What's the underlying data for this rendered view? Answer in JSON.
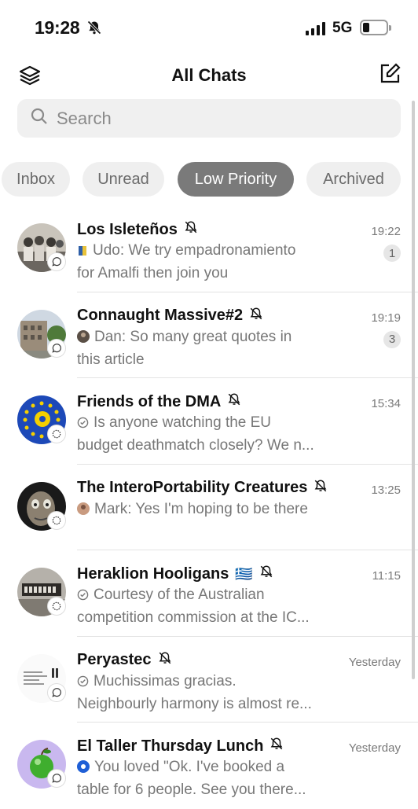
{
  "status": {
    "time": "19:28",
    "network": "5G"
  },
  "header": {
    "title": "All Chats"
  },
  "search": {
    "placeholder": "Search"
  },
  "filters": [
    {
      "label": "Inbox"
    },
    {
      "label": "Unread"
    },
    {
      "label": "Low Priority",
      "active": true
    },
    {
      "label": "Archived"
    }
  ],
  "chats": [
    {
      "name": "Los Isleteños",
      "time": "19:22",
      "unread": "1",
      "line1": "Udo: We try empadronamiento",
      "line2": "for Amalfi then join you"
    },
    {
      "name": "Connaught Massive#2",
      "time": "19:19",
      "unread": "3",
      "line1": "Dan: So many great quotes in",
      "line2": "this article"
    },
    {
      "name": "Friends of the DMA",
      "time": "15:34",
      "unread": "",
      "line1": "Is anyone watching the EU",
      "line2": "budget deathmatch closely? We n..."
    },
    {
      "name": "The InteroPortability Creatures",
      "time": "13:25",
      "unread": "",
      "line1": "Mark: Yes I'm hoping to be there",
      "line2": ""
    },
    {
      "name": "Heraklion Hooligans",
      "flag": "🇬🇷",
      "time": "11:15",
      "unread": "",
      "line1": "Courtesy of the Australian",
      "line2": "competition commission at the IC..."
    },
    {
      "name": "Peryastec",
      "time": "Yesterday",
      "unread": "",
      "line1": "Muchissimas gracias.",
      "line2": "Neighbourly harmony is almost re..."
    },
    {
      "name": "El Taller Thursday Lunch",
      "time": "Yesterday",
      "unread": "",
      "line1": "You loved \"Ok. I've booked a",
      "line2": "table for 6 people. See you there..."
    }
  ]
}
